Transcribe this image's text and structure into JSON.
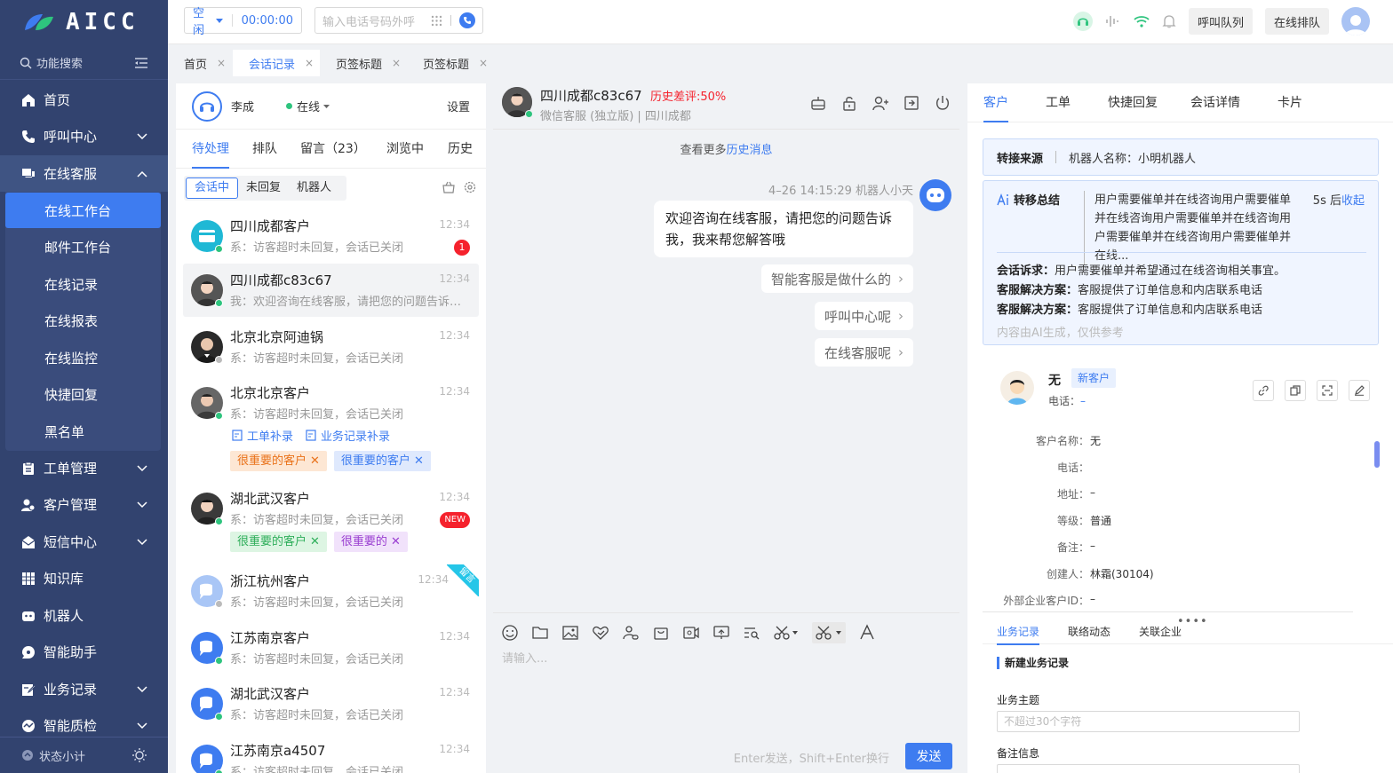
{
  "app": {
    "logo_text": "AICC"
  },
  "sidebar": {
    "search_label": "功能搜索",
    "items": [
      {
        "label": "首页",
        "icon": "home-icon"
      },
      {
        "label": "呼叫中心",
        "icon": "phone-icon"
      },
      {
        "label": "在线客服",
        "icon": "chat-icon"
      },
      {
        "label": "工单管理",
        "icon": "clipboard-icon"
      },
      {
        "label": "客户管理",
        "icon": "users-icon"
      },
      {
        "label": "短信中心",
        "icon": "mail-icon"
      },
      {
        "label": "知识库",
        "icon": "grid-icon"
      },
      {
        "label": "机器人",
        "icon": "robot-icon"
      },
      {
        "label": "智能助手",
        "icon": "assistant-icon"
      },
      {
        "label": "业务记录",
        "icon": "edit-icon"
      },
      {
        "label": "智能质检",
        "icon": "quality-icon"
      }
    ],
    "sub_items": [
      "在线工作台",
      "邮件工作台",
      "在线记录",
      "在线报表",
      "在线监控",
      "快捷回复",
      "黑名单"
    ],
    "footer_label": "状态小计"
  },
  "topbar": {
    "status": "空闲",
    "timer": "00:00:00",
    "dial_placeholder": "输入电话号码外呼",
    "call_queue_btn": "呼叫队列",
    "online_queue_btn": "在线排队"
  },
  "page_tabs": [
    {
      "label": "首页"
    },
    {
      "label": "会话记录"
    },
    {
      "label": "页签标题"
    },
    {
      "label": "页签标题"
    }
  ],
  "agent": {
    "name": "李成",
    "status": "在线",
    "settings": "设置"
  },
  "conv_tabs": [
    "待处理",
    "排队",
    "留言（23）",
    "浏览中",
    "历史"
  ],
  "conv_filters": [
    "会话中",
    "未回复",
    "机器人"
  ],
  "conversations": [
    {
      "name": "四川成都客户",
      "time": "12:34",
      "msg": "系：访客超时未回复，会话已关闭",
      "badge": "1"
    },
    {
      "name": "四川成都c83c67",
      "time": "12:34",
      "msg": "我：欢迎咨询在线客服，请把您的问题告诉我，我来帮您解答哦"
    },
    {
      "name": "北京北京阿迪锅",
      "time": "12:34",
      "msg": "系：访客超时未回复，会话已关闭"
    },
    {
      "name": "北京北京客户",
      "time": "12:34",
      "msg": "系：访客超时未回复，会话已关闭",
      "links": [
        "工单补录",
        "业务记录补录"
      ],
      "tags": [
        "很重要的客户",
        "很重要的客户"
      ]
    },
    {
      "name": "湖北武汉客户",
      "time": "12:34",
      "msg": "系：访客超时未回复，会话已关闭",
      "badge": "NEW",
      "tags": [
        "很重要的客户",
        "很重要的"
      ]
    },
    {
      "name": "浙江杭州客户",
      "time": "12:34",
      "msg": "系：访客超时未回复，会话已关闭",
      "ribbon": "留言"
    },
    {
      "name": "江苏南京客户",
      "time": "12:34",
      "msg": "系：访客超时未回复，会话已关闭"
    },
    {
      "name": "湖北武汉客户",
      "time": "12:34",
      "msg": "系：访客超时未回复，会话已关闭"
    },
    {
      "name": "江苏南京a4507",
      "time": "12:34",
      "msg": "系：访客超时未回复，会话已关闭"
    }
  ],
  "chat": {
    "name": "四川成都c83c67",
    "warn": "历史差评:50%",
    "sub": "微信客服 (独立版) | 四川成都",
    "history_prefix": "查看更多",
    "history_link": "历史消息",
    "msg_meta": "4–26 14:15:29 机器人小天",
    "bot_msg": "欢迎咨询在线客服，请把您的问题告诉我，我来帮您解答哦",
    "quick": [
      "智能客服是做什么的",
      "呼叫中心呢",
      "在线客服呢"
    ],
    "input_placeholder": "请输入...",
    "send_hint": "Enter发送，Shift+Enter换行",
    "send_label": "发送"
  },
  "right": {
    "tabs": [
      "客户",
      "工单",
      "快捷回复",
      "会话详情",
      "卡片"
    ],
    "source_key": "转接来源",
    "source_val": "机器人名称：小明机器人",
    "summary_title": "转移总结",
    "summary_text": "用户需要催单并在线咨询用户需要催单并在线咨询用户需要催单并在线咨询用户需要催单并在线咨询用户需要催单并在线...",
    "summary_timer": "5s 后",
    "summary_collapse": "收起",
    "appeal_k": "会话诉求：",
    "appeal_v": "用户需要催单并希望通过在线咨询相关事宜。",
    "solution_k": "客服解决方案：",
    "solution_v": "客服提供了订单信息和内店联系电话",
    "ai_note": "内容由AI生成，仅供参考",
    "customer": {
      "name": "无",
      "badge": "新客户",
      "phone_label": "电话：",
      "phone_val": "–"
    },
    "fields": [
      {
        "k": "客户名称：",
        "v": "无"
      },
      {
        "k": "电话：",
        "v": ""
      },
      {
        "k": "地址：",
        "v": "–"
      },
      {
        "k": "等级：",
        "v": "普通"
      },
      {
        "k": "备注：",
        "v": "–"
      },
      {
        "k": "创建人：",
        "v": "林霜(30104)"
      },
      {
        "k": "外部企业客户ID：",
        "v": "–"
      }
    ],
    "bottom_tabs": [
      "业务记录",
      "联络动态",
      "关联企业"
    ],
    "new_record": "新建业务记录",
    "subject_label": "业务主题",
    "subject_placeholder": "不超过30个字符",
    "note_label": "备注信息"
  },
  "colors": {
    "sidebar": "#32436f",
    "accent": "#3e7cf0",
    "danger": "#f5222d",
    "online": "#2ec47e"
  }
}
